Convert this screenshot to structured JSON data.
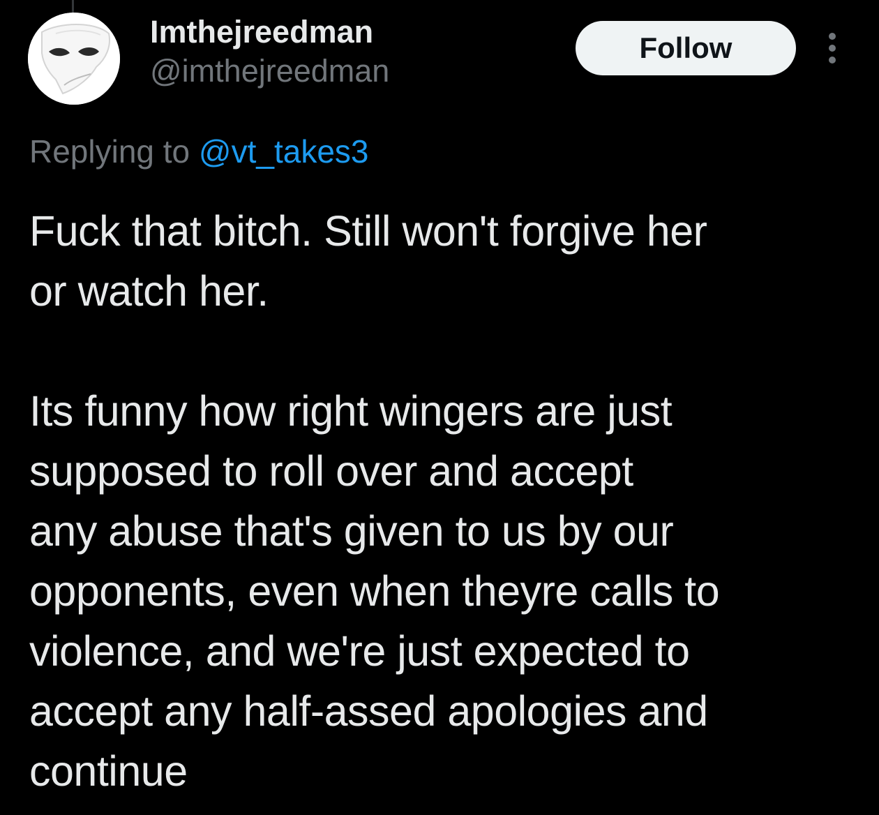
{
  "author": {
    "display_name": "Imthejreedman",
    "handle": "@imthejreedman",
    "avatar_icon": "theater-mask-avatar"
  },
  "actions": {
    "follow_label": "Follow",
    "more_icon": "vertical-ellipsis-icon"
  },
  "reply": {
    "prefix": "Replying to ",
    "mention": "@vt_takes3"
  },
  "tweet": {
    "paragraph_1": "Fuck that bitch. Still won't forgive her\nor watch her.",
    "paragraph_2": "Its funny how right wingers are just\nsupposed to roll over and accept\nany abuse that's given to us by our\nopponents, even when theyre calls to\nviolence, and we're just expected to\naccept any half-assed apologies and\ncontinue"
  },
  "colors": {
    "background": "#000000",
    "text_primary": "#e7e9ea",
    "text_secondary": "#71767b",
    "link": "#1d9bf0",
    "button_bg": "#eff3f4",
    "button_text": "#0f1419"
  }
}
